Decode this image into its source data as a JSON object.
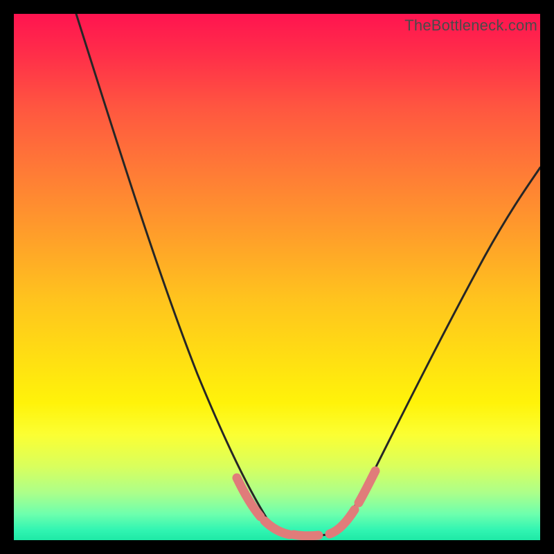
{
  "watermark": "TheBottleneck.com",
  "colors": {
    "frame_bg": "#000000",
    "curve_stroke": "#262626",
    "highlight_stroke": "#e07c7a",
    "gradient_top": "#ff1450",
    "gradient_bottom": "#1ee9a6"
  },
  "chart_data": {
    "type": "line",
    "title": "",
    "xlabel": "",
    "ylabel": "",
    "xlim": [
      0,
      100
    ],
    "ylim": [
      0,
      100
    ],
    "series": [
      {
        "name": "left-curve",
        "x": [
          12,
          18,
          24,
          30,
          35,
          40,
          44,
          47.5,
          51
        ],
        "y": [
          100,
          80,
          60,
          42,
          28,
          16,
          8,
          3,
          1
        ]
      },
      {
        "name": "right-curve",
        "x": [
          60,
          64,
          70,
          78,
          86,
          94,
          100
        ],
        "y": [
          1,
          4,
          13,
          28,
          45,
          60,
          71
        ]
      },
      {
        "name": "valley-floor",
        "x": [
          51,
          55,
          60
        ],
        "y": [
          1,
          0.7,
          1
        ]
      },
      {
        "name": "highlight-left",
        "x": [
          42,
          44,
          47.5,
          51,
          55
        ],
        "y": [
          11,
          8,
          3,
          1,
          0.7
        ]
      },
      {
        "name": "highlight-right",
        "x": [
          60,
          63.5,
          67
        ],
        "y": [
          1,
          3.5,
          9
        ]
      }
    ]
  }
}
